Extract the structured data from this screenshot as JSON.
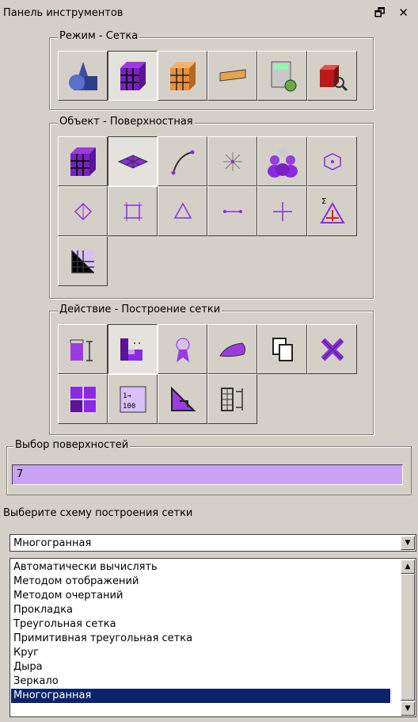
{
  "panel": {
    "title": "Панель инструментов",
    "controls": "🗗 ✕"
  },
  "groups": {
    "mode": {
      "legend": "Режим - Сетка",
      "icons": [
        "geometry-icon",
        "mesh-cube-icon",
        "mesh-cube-orange-icon",
        "boundary-condition-icon",
        "calculator-icon",
        "results-icon"
      ]
    },
    "object": {
      "legend": "Объект - Поверхностная",
      "icons": [
        "volume-mesh-icon",
        "surface-mesh-icon",
        "curve-icon",
        "point-icon",
        "group-icon",
        "node-icon",
        "vertex-node-icon",
        "quad-element-icon",
        "tri-element-icon",
        "edge-element-icon",
        "point-element-icon",
        "mesh-info-icon",
        "layer-icon"
      ]
    },
    "action": {
      "legend": "Действие - Построение сетки",
      "icons": [
        "mesh-vertical-icon",
        "mesh-build-icon",
        "quality-icon",
        "smooth-icon",
        "copy-icon",
        "delete-icon",
        "refine-icon",
        "numbering-icon",
        "transform-icon",
        "extrude-icon"
      ]
    }
  },
  "surface_select": {
    "legend": "Выбор поверхностей",
    "value": "7"
  },
  "scheme": {
    "label": "Выберите схему построения сетки",
    "selected": "Многогранная",
    "options": [
      "Автоматически вычислять",
      "Методом отображений",
      "Методом очертаний",
      "Прокладка",
      "Треугольная сетка",
      "Примитивная треугольная сетка",
      "Круг",
      "Дыра",
      "Зеркало",
      "Многогранная"
    ]
  },
  "colors": {
    "accent": "#c9a3f5",
    "purple": "#8a2be2",
    "selection": "#0a246a"
  }
}
